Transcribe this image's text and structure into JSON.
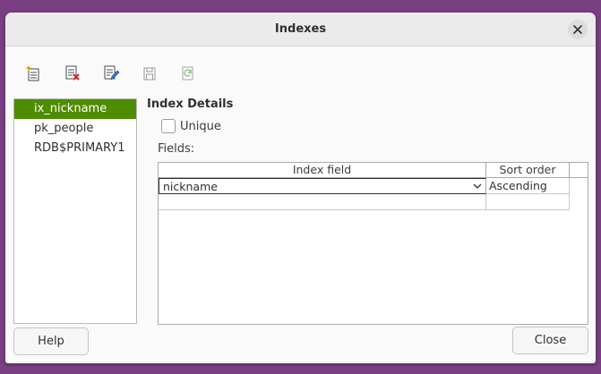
{
  "window": {
    "title": "Indexes"
  },
  "toolbar": {
    "buttons": [
      {
        "name": "new-index",
        "icon": "new-index-icon"
      },
      {
        "name": "delete-index",
        "icon": "delete-index-icon"
      },
      {
        "name": "rename-index",
        "icon": "rename-index-icon"
      },
      {
        "name": "save-index",
        "icon": "save-index-icon"
      },
      {
        "name": "reset-index",
        "icon": "reset-index-icon"
      }
    ]
  },
  "index_list": {
    "items": [
      {
        "label": "ix_nickname",
        "selected": true
      },
      {
        "label": "pk_people",
        "selected": false
      },
      {
        "label": "RDB$PRIMARY1",
        "selected": false
      }
    ]
  },
  "details": {
    "title": "Index Details",
    "unique_label": "Unique",
    "unique_checked": false,
    "fields_label": "Fields:"
  },
  "grid": {
    "headers": {
      "field": "Index field",
      "order": "Sort order"
    },
    "rows": [
      {
        "field": "nickname",
        "order": "Ascending"
      },
      {
        "field": "",
        "order": ""
      }
    ]
  },
  "buttons": {
    "help": "Help",
    "close": "Close"
  },
  "colors": {
    "accent": "#4e8c00",
    "frame": "#7a3f82"
  }
}
